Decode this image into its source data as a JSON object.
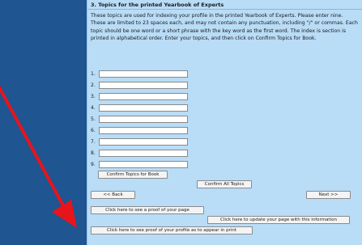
{
  "section": {
    "title": "3. Topics for the printed Yearbook of Experts",
    "instructions": "These topics are used for indexing your profile in the printed Yearbook of Experts. Please enter nine. These are limited to 23 spaces each, and may not contain any punctuation, including \"/\" or commas. Each topic should be one word or a short phrase with the key word as the first word. The index is section is printed in alphabetical order. Enter your topics, and then click on Confirm Topics for Book."
  },
  "topics": [
    {
      "number": "1.",
      "value": ""
    },
    {
      "number": "2.",
      "value": ""
    },
    {
      "number": "3.",
      "value": ""
    },
    {
      "number": "4.",
      "value": ""
    },
    {
      "number": "5.",
      "value": ""
    },
    {
      "number": "6.",
      "value": ""
    },
    {
      "number": "7.",
      "value": ""
    },
    {
      "number": "8.",
      "value": ""
    },
    {
      "number": "9.",
      "value": ""
    }
  ],
  "buttons": {
    "confirm_topics": "Confirm Topics for Book",
    "confirm_all": "Confirm All Topics",
    "back": "<< Back",
    "next": "Next >>",
    "see_proof": "Click here to see a proof of your page",
    "update_page": "Click here to update your page with this information",
    "print_proof": "Click here to see proof of your profile as to appear in print"
  },
  "colors": {
    "side_panel": "#1f5590",
    "content_bg": "#b9dcf7",
    "arrow": "#e8141c"
  },
  "icons": {
    "arrow": "red-arrow-icon"
  }
}
